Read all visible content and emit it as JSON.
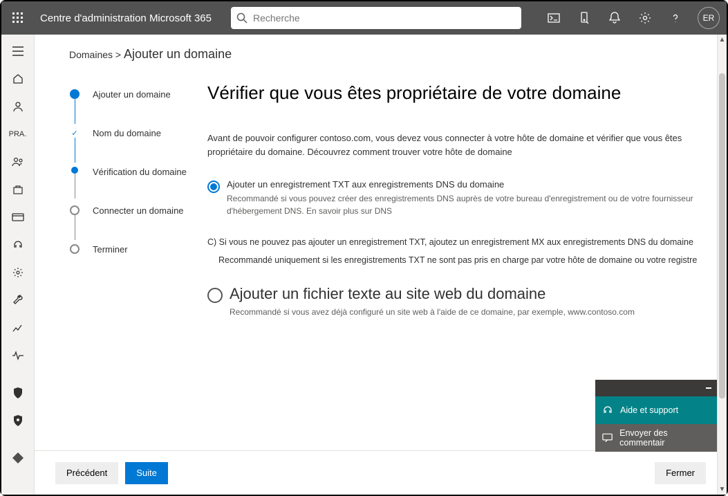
{
  "header": {
    "app_title": "Centre d'administration Microsoft 365",
    "search_placeholder": "Recherche",
    "avatar_initials": "ER"
  },
  "leftrail": {
    "label": "PRA."
  },
  "breadcrumb": {
    "parent": "Domaines >",
    "current": "Ajouter un domaine"
  },
  "steps": [
    {
      "label": "Ajouter un domaine"
    },
    {
      "label": "Nom du domaine"
    },
    {
      "label": "Vérification du domaine"
    },
    {
      "label": "Connecter un domaine"
    },
    {
      "label": "Terminer"
    }
  ],
  "pane": {
    "title": "Vérifier que vous êtes propriétaire de votre domaine",
    "intro": "Avant de pouvoir configurer contoso.com, vous devez vous connecter à votre hôte de domaine et vérifier que vous êtes propriétaire du domaine. Découvrez comment trouver votre hôte de domaine",
    "option1": {
      "title": "Ajouter un enregistrement TXT aux enregistrements DNS du domaine",
      "desc": "Recommandé si vous pouvez créer des enregistrements DNS auprès de votre bureau d'enregistrement ou de votre fournisseur d'hébergement DNS. En savoir plus sur DNS"
    },
    "option1b": {
      "title": "C) Si vous ne pouvez pas ajouter un enregistrement TXT, ajoutez un enregistrement MX aux enregistrements DNS du domaine",
      "desc": "Recommandé uniquement si les enregistrements TXT ne sont pas pris en charge par votre hôte de domaine ou votre registre"
    },
    "option2": {
      "title": "Ajouter un fichier texte au site web du domaine",
      "desc": "Recommandé si vous avez déjà configuré un site web à l'aide de ce domaine, par exemple, www.contoso.com"
    }
  },
  "footer": {
    "back": "Précédent",
    "next": "Suite",
    "close": "Fermer"
  },
  "help": {
    "support": "Aide et support",
    "feedback": "Envoyer des commentair"
  }
}
